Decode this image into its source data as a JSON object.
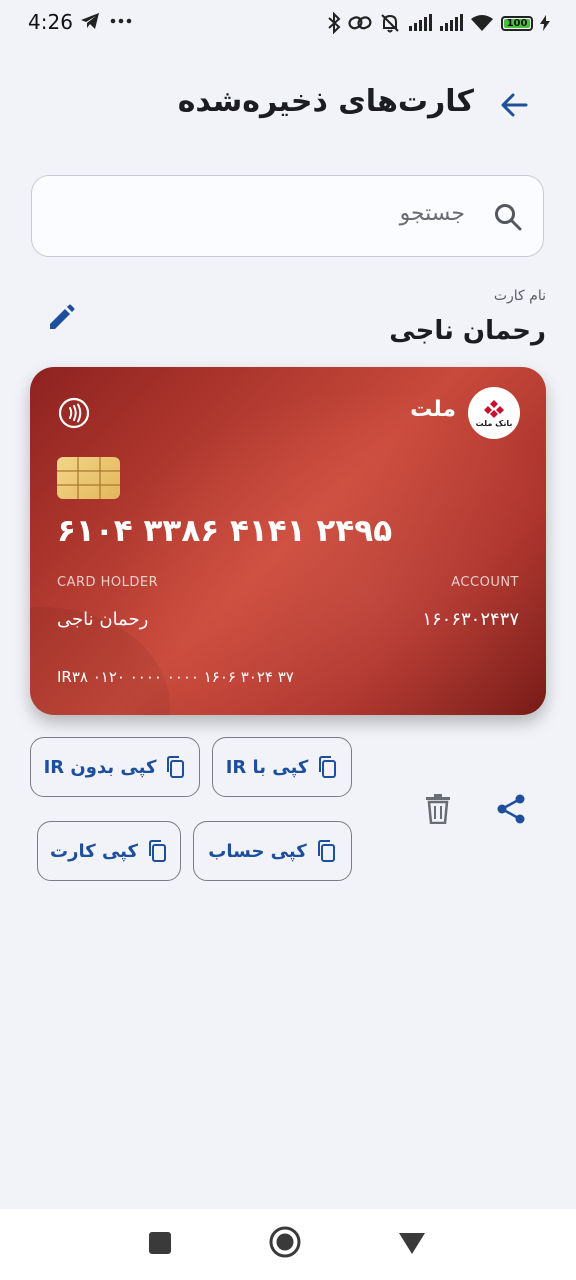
{
  "status_bar": {
    "time": "4:26",
    "battery_level": "100",
    "colors": {
      "battery_fill": "#46c03a"
    }
  },
  "header": {
    "title": "کارت‌های ذخیره‌شده"
  },
  "search": {
    "placeholder": "جستجو"
  },
  "card_name": {
    "label": "نام کارت",
    "value": "رحمان ناجی"
  },
  "card": {
    "bank_name": "ملت",
    "bank_logo_text": "بانک ملت",
    "card_number": "۶۱۰۴ ۳۳۸۶ ۴۱۴۱ ۲۴۹۵",
    "holder_label": "CARD HOLDER",
    "holder_name": "رحمان ناجی",
    "account_label": "ACCOUNT",
    "account_number": "۱۶۰۶۳۰۲۴۳۷",
    "iban": "IR۳۸ ۰۱۲۰ ۰۰۰۰ ۰۰۰۰ ۱۶۰۶ ۳۰۲۴ ۳۷",
    "colors": {
      "primary": "#b23a30",
      "dark": "#6e1512"
    }
  },
  "actions": {
    "copy_without_ir": "کپی بدون IR",
    "copy_with_ir": "کپی با IR",
    "copy_card": "کپی کارت",
    "copy_account": "کپی حساب",
    "delete_icon": "trash-icon",
    "share_icon": "share-icon",
    "colors": {
      "accent": "#1d4f9c"
    }
  },
  "nav_bar": {
    "icons": [
      "recents-square-icon",
      "home-circle-icon",
      "back-triangle-icon"
    ]
  }
}
